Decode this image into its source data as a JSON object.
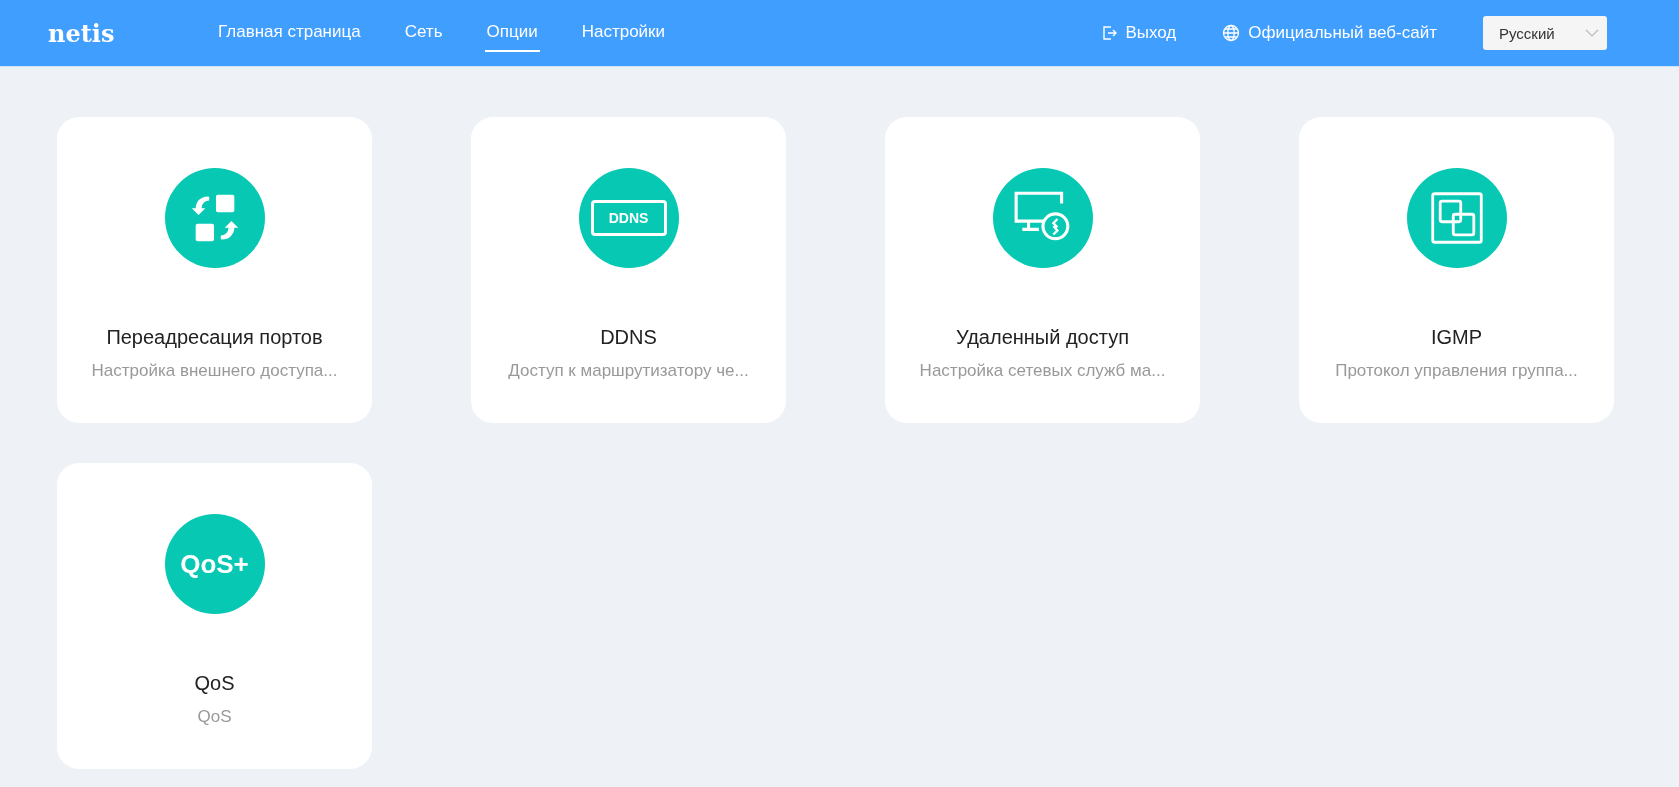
{
  "header": {
    "logo": "netis",
    "nav": [
      {
        "label": "Главная страница",
        "selected": false
      },
      {
        "label": "Сеть",
        "selected": false
      },
      {
        "label": "Опции",
        "selected": true
      },
      {
        "label": "Настройки",
        "selected": false
      }
    ],
    "logout": "Выход",
    "website": "Официальный веб-сайт",
    "language": "Русский"
  },
  "cards": [
    {
      "kind": "ports",
      "title": "Переадресация портов",
      "subtitle": "Настройка внешнего доступа..."
    },
    {
      "kind": "ddns",
      "icon_text": "DDNS",
      "title": "DDNS",
      "subtitle": "Доступ к маршрутизатору че..."
    },
    {
      "kind": "remote",
      "title": "Удаленный доступ",
      "subtitle": "Настройка сетевых служб ма..."
    },
    {
      "kind": "igmp",
      "title": "IGMP",
      "subtitle": "Протокол управления группа..."
    },
    {
      "kind": "qos",
      "icon_text": "QoS+",
      "title": "QoS",
      "subtitle": "QoS"
    }
  ]
}
